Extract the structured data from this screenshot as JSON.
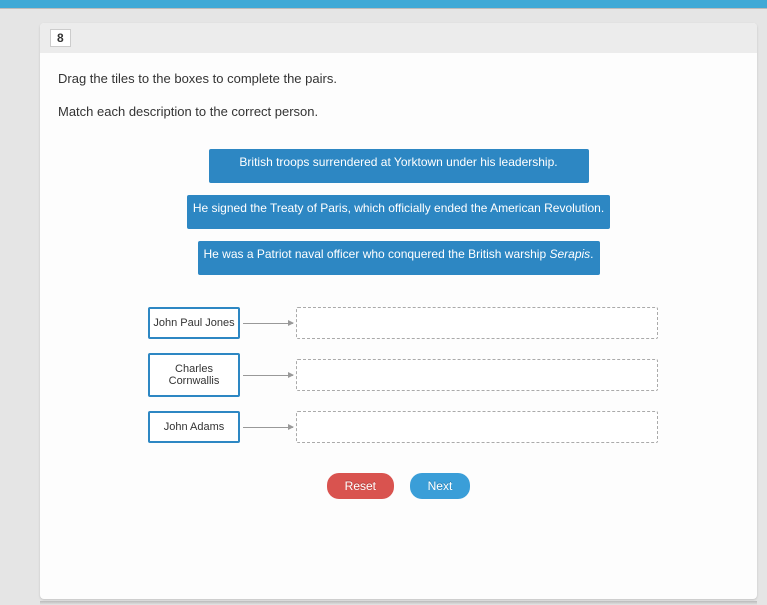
{
  "questionNumber": "8",
  "instruction1": "Drag the tiles to the boxes to complete the pairs.",
  "instruction2": "Match each description to the correct person.",
  "tiles": [
    {
      "text": "British troops surrendered at Yorktown under his leadership."
    },
    {
      "text": "He signed the Treaty of Paris, which officially ended the American Revolution."
    },
    {
      "prefix": "He was a Patriot naval officer who conquered the British warship ",
      "italic": "Serapis",
      "suffix": "."
    }
  ],
  "people": [
    "John Paul Jones",
    "Charles Cornwallis",
    "John Adams"
  ],
  "buttons": {
    "reset": "Reset",
    "next": "Next"
  }
}
